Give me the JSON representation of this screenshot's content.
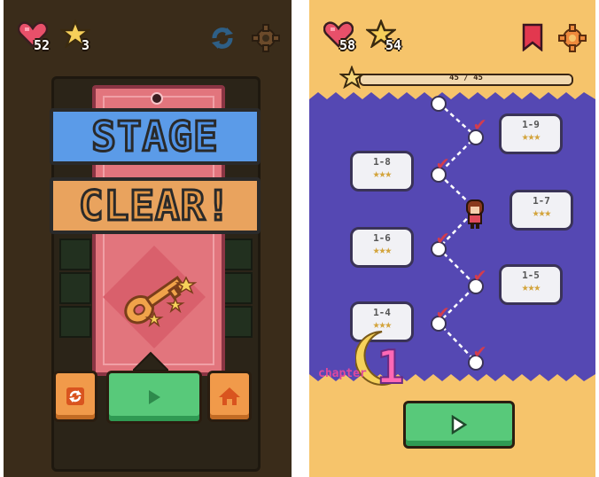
{
  "left_screen": {
    "hearts": "52",
    "stars": "3",
    "title_line1": "STAGE",
    "title_line2": "CLEAR!",
    "colors": {
      "background": "#3a2c1a",
      "banner": "#e2757d",
      "stage": "#5b9be8",
      "clear": "#e9a35e",
      "play": "#58c97a",
      "side_button": "#f19a4a"
    },
    "icons": [
      "heart-icon",
      "star-icon",
      "refresh-icon",
      "gear-icon",
      "key-icon",
      "restart-icon",
      "play-icon",
      "home-icon"
    ]
  },
  "right_screen": {
    "hearts": "58",
    "stars": "54",
    "progress_text": "45 / 45",
    "progress_value": 1.0,
    "levels": [
      {
        "label": "1-9",
        "stars": "★★★"
      },
      {
        "label": "1-8",
        "stars": "★★★"
      },
      {
        "label": "1-7",
        "stars": "★★★"
      },
      {
        "label": "1-6",
        "stars": "★★★"
      },
      {
        "label": "1-5",
        "stars": "★★★"
      },
      {
        "label": "1-4",
        "stars": "★★★"
      }
    ],
    "chapter_word": "chapter",
    "chapter_number": "1",
    "colors": {
      "background": "#f6c46b",
      "map": "#5548b3",
      "check": "#d43c4c",
      "play": "#58c97a",
      "bookmark": "#e2384f"
    },
    "icons": [
      "heart-icon",
      "star-icon",
      "bookmark-icon",
      "gear-icon",
      "checkmark-icon",
      "character-icon",
      "play-icon"
    ]
  }
}
